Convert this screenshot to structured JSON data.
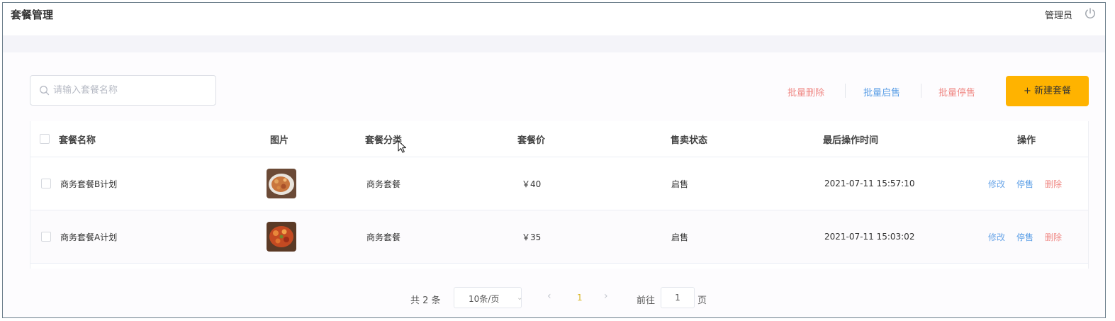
{
  "header": {
    "title": "套餐管理",
    "user": "管理员",
    "logout_icon": "power-icon"
  },
  "toolbar": {
    "search_placeholder": "请输入套餐名称",
    "batch_delete": "批量删除",
    "batch_enable": "批量启售",
    "batch_disable": "批量停售",
    "new_button": "+ 新建套餐"
  },
  "table": {
    "columns": [
      "套餐名称",
      "图片",
      "套餐分类",
      "套餐价",
      "售卖状态",
      "最后操作时间",
      "操作"
    ],
    "rows": [
      {
        "name": "商务套餐B计划",
        "image_icon": "food-thumbnail",
        "category": "商务套餐",
        "price": "￥40",
        "status": "启售",
        "updated": "2021-07-11 15:57:10",
        "actions": [
          "修改",
          "停售",
          "删除"
        ]
      },
      {
        "name": "商务套餐A计划",
        "image_icon": "food-thumbnail",
        "category": "商务套餐",
        "price": "￥35",
        "status": "启售",
        "updated": "2021-07-11 15:03:02",
        "actions": [
          "修改",
          "停售",
          "删除"
        ]
      }
    ]
  },
  "pagination": {
    "total": "共 2 条",
    "page_size": "10条/页",
    "current_page": "1",
    "goto_label": "前往",
    "goto_value": "1",
    "page_label": "页"
  },
  "colors": {
    "accent": "#ffb300",
    "danger_link": "#f08a86",
    "primary_link": "#5a9ee6"
  }
}
